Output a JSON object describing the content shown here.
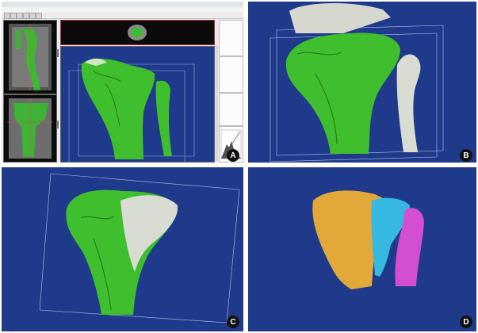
{
  "figure": {
    "panels": [
      {
        "label": "A"
      },
      {
        "label": "B"
      },
      {
        "label": "C"
      },
      {
        "label": "D"
      }
    ]
  },
  "colors": {
    "background_navy": "#1f3a8a",
    "bone_green": "#3fbf2e",
    "bone_white": "#d9dcd2",
    "tibia_yellow": "#e2a93a",
    "segment_cyan": "#35b9e0",
    "fibula_magenta": "#d44fd0"
  }
}
